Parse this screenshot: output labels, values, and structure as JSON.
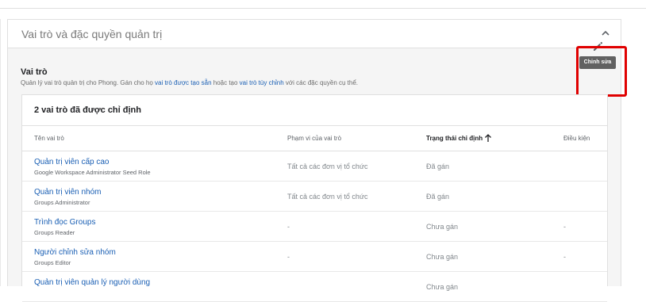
{
  "panel": {
    "title": "Vai trò và đặc quyền quản trị"
  },
  "roles_section": {
    "title": "Vai trò",
    "desc_prefix": "Quản lý vai trò quản trị cho Phong. Gán cho họ ",
    "link_prebuilt": "vai trò được tạo sẵn",
    "desc_middle": " hoặc tạo ",
    "link_custom": "vai trò tùy chỉnh",
    "desc_suffix": " với các đặc quyền cụ thể.",
    "edit_tooltip": "Chỉnh sửa"
  },
  "table": {
    "heading": "2 vai trò đã được chỉ định",
    "columns": {
      "name": "Tên vai trò",
      "scope": "Phạm vi của vai trò",
      "status": "Trạng thái chỉ định",
      "conditions": "Điều kiện"
    },
    "rows": [
      {
        "name": "Quản trị viên cấp cao",
        "sub": "Google Workspace Administrator Seed Role",
        "scope": "Tất cả các đơn vị tổ chức",
        "status": "Đã gán",
        "conditions": ""
      },
      {
        "name": "Quản trị viên nhóm",
        "sub": "Groups Administrator",
        "scope": "Tất cả các đơn vị tổ chức",
        "status": "Đã gán",
        "conditions": ""
      },
      {
        "name": "Trình đọc Groups",
        "sub": "Groups Reader",
        "scope": "-",
        "status": "Chưa gán",
        "conditions": "-"
      },
      {
        "name": "Người chỉnh sửa nhóm",
        "sub": "Groups Editor",
        "scope": "-",
        "status": "Chưa gán",
        "conditions": "-"
      },
      {
        "name": "Quản trị viên quản lý người dùng",
        "sub": "",
        "scope": "",
        "status": "Chưa gán",
        "conditions": ""
      }
    ]
  },
  "colors": {
    "link": "#1a5fb4",
    "annotation_red": "#e00000",
    "tooltip_bg": "#616161"
  },
  "icons": {
    "edit": "pencil-icon",
    "collapse": "chevron-up-icon",
    "sort": "arrow-up-icon"
  }
}
